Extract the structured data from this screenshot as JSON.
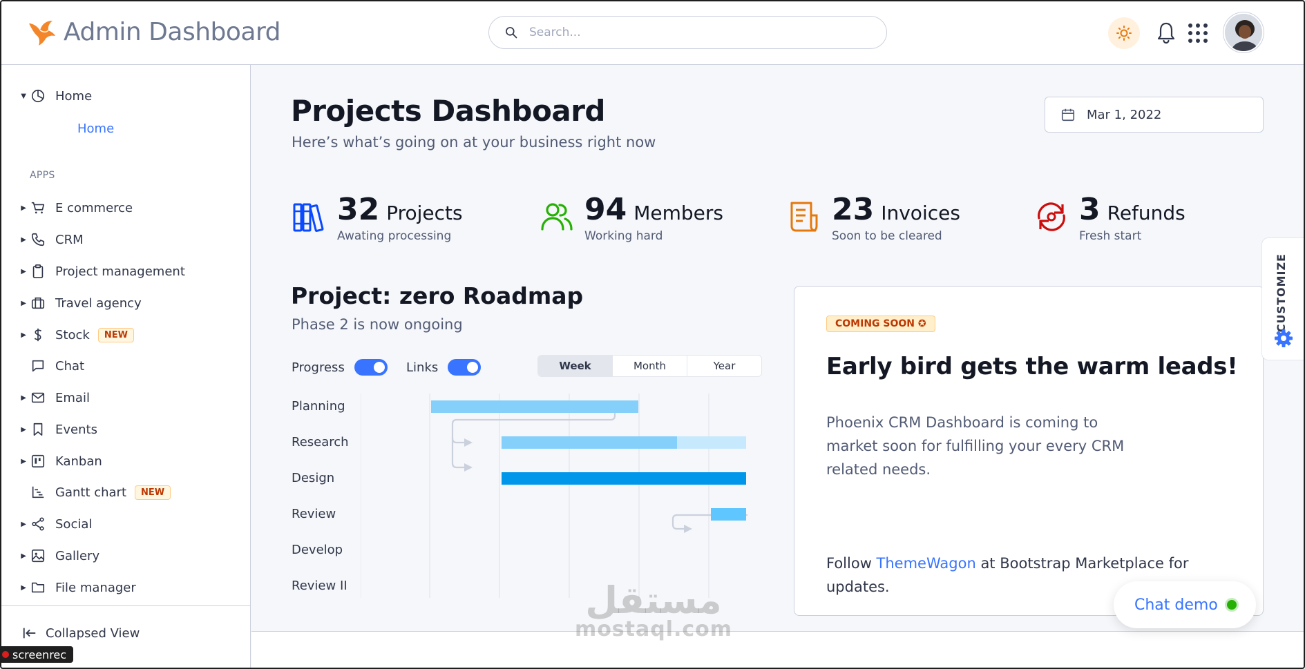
{
  "app": {
    "title": "Admin Dashboard"
  },
  "search": {
    "placeholder": "Search..."
  },
  "sidebar": {
    "home_group": "Home",
    "home_sub": "Home",
    "section_label": "APPS",
    "items": [
      {
        "label": "E commerce",
        "badge": ""
      },
      {
        "label": "CRM",
        "badge": ""
      },
      {
        "label": "Project management",
        "badge": ""
      },
      {
        "label": "Travel agency",
        "badge": ""
      },
      {
        "label": "Stock",
        "badge": "NEW"
      },
      {
        "label": "Chat",
        "badge": ""
      },
      {
        "label": "Email",
        "badge": ""
      },
      {
        "label": "Events",
        "badge": ""
      },
      {
        "label": "Kanban",
        "badge": ""
      },
      {
        "label": "Gantt chart",
        "badge": "NEW"
      },
      {
        "label": "Social",
        "badge": ""
      },
      {
        "label": "Gallery",
        "badge": ""
      },
      {
        "label": "File manager",
        "badge": ""
      }
    ],
    "collapse_label": "Collapsed View"
  },
  "main": {
    "title": "Projects Dashboard",
    "subtitle": "Here’s what’s going on at your business right now",
    "date": "Mar 1, 2022",
    "stats": [
      {
        "num": "32",
        "label": "Projects",
        "caption": "Awating processing",
        "color": "#0a49ff"
      },
      {
        "num": "94",
        "label": "Members",
        "caption": "Working hard",
        "color": "#25b003"
      },
      {
        "num": "23",
        "label": "Invoices",
        "caption": "Soon to be cleared",
        "color": "#e5780b"
      },
      {
        "num": "3",
        "label": "Refunds",
        "caption": "Fresh start",
        "color": "#cc0d0d"
      }
    ]
  },
  "roadmap": {
    "title": "Project: zero Roadmap",
    "subtitle": "Phase 2 is now ongoing",
    "toggle_progress": "Progress",
    "toggle_links": "Links",
    "segments": [
      "Week",
      "Month",
      "Year"
    ],
    "active_segment": "Week",
    "tasks": [
      "Planning",
      "Research",
      "Design",
      "Review",
      "Develop",
      "Review II"
    ]
  },
  "promo": {
    "badge": "COMING SOON",
    "title": "Early bird gets the warm leads!",
    "body": "Phoenix CRM Dashboard is coming to market soon for fulfilling your every CRM related needs.",
    "follow_pre": "Follow ",
    "follow_link": "ThemeWagon",
    "follow_post": " at Bootstrap Marketplace for updates."
  },
  "customize": {
    "label": "CUSTOMIZE"
  },
  "chat_demo": {
    "label": "Chat demo"
  },
  "watermark": {
    "arabic": "مستقل",
    "latin": "mostaql.com"
  },
  "screenrec": {
    "label": "screenrec"
  },
  "colors": {
    "accent": "#3874ff",
    "warning_bg": "#fff1dd",
    "gantt_light": "#b5e0fb",
    "gantt_dark": "#0097eb"
  }
}
